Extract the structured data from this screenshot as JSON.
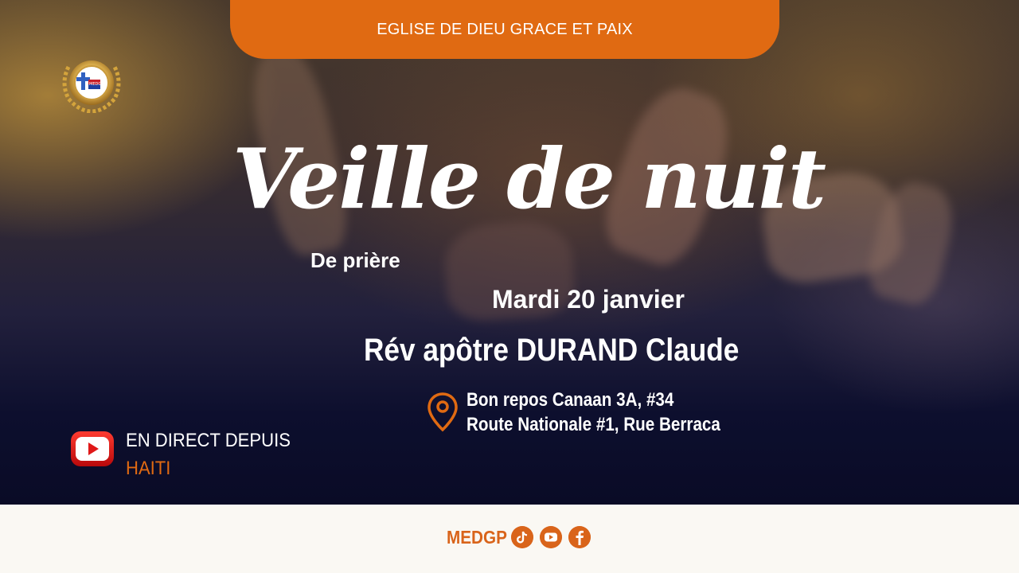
{
  "header": {
    "church_name": "EGLISE DE DIEU GRACE ET PAIX"
  },
  "logo": {
    "icon": "medgp-church-emblem",
    "text": "MEDGP"
  },
  "event": {
    "title": "Veille de nuit",
    "subtitle": "De prière",
    "date": "Mardi 20 janvier",
    "speaker": "Rév apôtre DURAND Claude"
  },
  "location": {
    "icon": "location-pin-icon",
    "line1": "Bon repos Canaan 3A, #34",
    "line2": "Route Nationale #1, Rue Berraca"
  },
  "live": {
    "icon": "youtube-icon",
    "label": "EN DIRECT DEPUIS",
    "place": "HAITI"
  },
  "footer": {
    "brand": "MEDGP",
    "social_icons": [
      "tiktok-icon",
      "youtube-icon",
      "facebook-icon"
    ]
  },
  "colors": {
    "accent": "#e06a12",
    "footer_bg": "#faf8f3",
    "text": "#ffffff"
  }
}
